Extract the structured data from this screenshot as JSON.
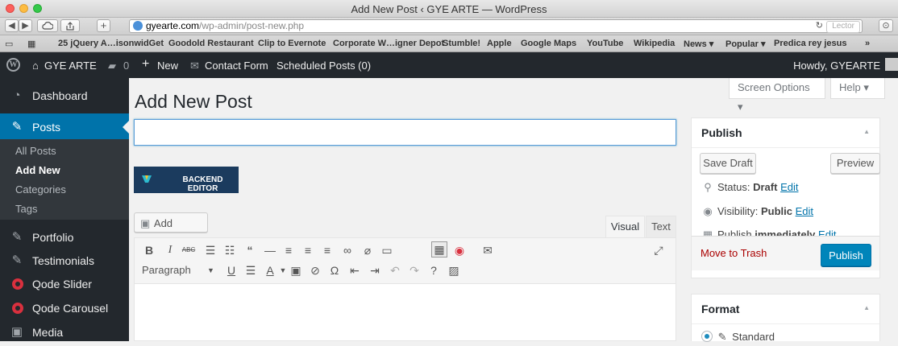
{
  "window": {
    "title": "Add New Post ‹ GYE ARTE — WordPress"
  },
  "browser": {
    "url_domain": "gyearte.com",
    "url_path": "/wp-admin/post-new.php",
    "reader_label": "Lector",
    "bookmarks": [
      "25 jQuery A…isonwidGet",
      "Goodold Restaurant",
      "Clip to Evernote",
      "Corporate W…igner Depot",
      "Stumble!",
      "Apple",
      "Google Maps",
      "YouTube",
      "Wikipedia",
      "News ▾",
      "Popular ▾",
      "Predica rey jesus"
    ],
    "bookmarks_overflow": "»"
  },
  "adminbar": {
    "site_name": "GYE ARTE",
    "comments_count": "0",
    "new_label": "New",
    "contact_form_label": "Contact Form",
    "scheduled_label": "Scheduled Posts (0)",
    "howdy": "Howdy, GYEARTE"
  },
  "sidebar": {
    "dashboard": "Dashboard",
    "posts": "Posts",
    "submenu": [
      "All Posts",
      "Add New",
      "Categories",
      "Tags"
    ],
    "portfolio": "Portfolio",
    "testimonials": "Testimonials",
    "qode_slider": "Qode Slider",
    "qode_carousel": "Qode Carousel",
    "media": "Media"
  },
  "screen_meta": {
    "screen_options": "Screen Options ▾",
    "help": "Help ▾"
  },
  "main": {
    "page_title": "Add New Post",
    "title_value": "",
    "backend_editor_label": "BACKEND EDITOR",
    "add_media_label": "Add Media",
    "tab_visual": "Visual",
    "tab_text": "Text",
    "format_select_value": "Paragraph"
  },
  "publish_box": {
    "title": "Publish",
    "save_draft": "Save Draft",
    "preview": "Preview",
    "status_label": "Status:",
    "status_value": "Draft",
    "visibility_label": "Visibility:",
    "visibility_value": "Public",
    "publish_label": "Publish",
    "publish_value": "immediately",
    "edit": "Edit",
    "move_to_trash": "Move to Trash",
    "publish_button": "Publish"
  },
  "format_box": {
    "title": "Format",
    "option_standard": "Standard"
  },
  "colors": {
    "admin_dark": "#23282d",
    "accent_blue": "#0073aa",
    "publish_blue": "#0085ba",
    "trash_red": "#a00"
  }
}
